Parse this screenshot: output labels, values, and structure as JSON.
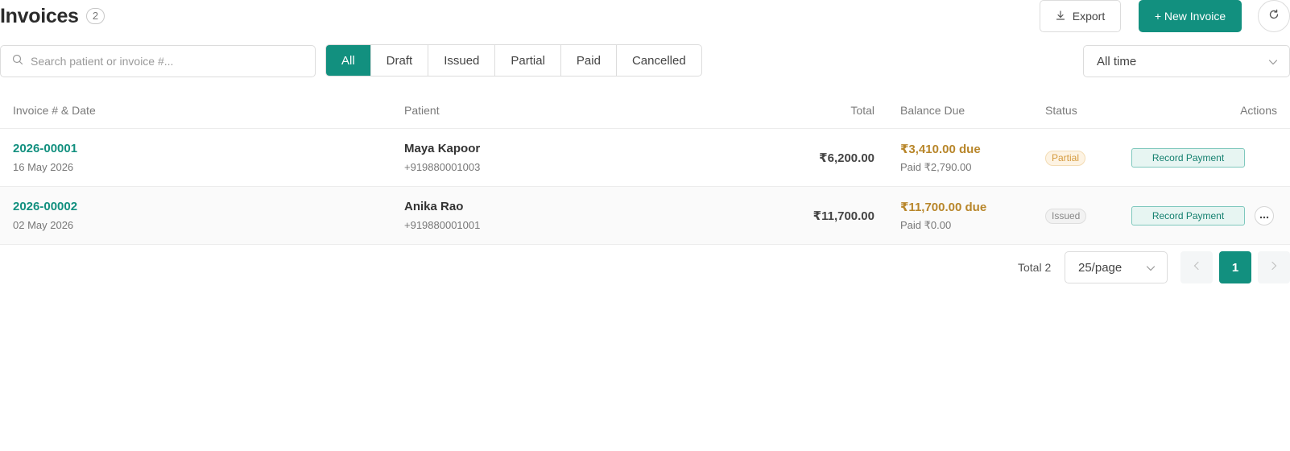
{
  "header": {
    "title": "Invoices",
    "count": "2",
    "export_label": "Export",
    "new_label": "+ New Invoice"
  },
  "filters": {
    "search_placeholder": "Search patient or invoice #...",
    "tabs": [
      "All",
      "Draft",
      "Issued",
      "Partial",
      "Paid",
      "Cancelled"
    ],
    "active_tab": "All",
    "time_range": "All time"
  },
  "table": {
    "columns": {
      "invoice": "Invoice # & Date",
      "patient": "Patient",
      "total": "Total",
      "balance": "Balance Due",
      "status": "Status",
      "actions": "Actions"
    },
    "rows": [
      {
        "invoice_no": "2026-00001",
        "date": "16 May 2026",
        "patient": "Maya Kapoor",
        "phone": "+919880001003",
        "total": "₹6,200.00",
        "due": "₹3,410.00 due",
        "paid": "Paid ₹2,790.00",
        "status": "Partial",
        "action": "Record Payment"
      },
      {
        "invoice_no": "2026-00002",
        "date": "02 May 2026",
        "patient": "Anika Rao",
        "phone": "+919880001001",
        "total": "₹11,700.00",
        "due": "₹11,700.00 due",
        "paid": "Paid ₹0.00",
        "status": "Issued",
        "action": "Record Payment"
      }
    ]
  },
  "pagination": {
    "total_label": "Total 2",
    "page_size": "25/page",
    "current_page": "1"
  },
  "colors": {
    "accent": "#12907f",
    "due": "#b8862a",
    "partial": "#d59b3f"
  },
  "icons": {
    "export": "download-icon",
    "refresh": "refresh-icon",
    "search": "search-icon",
    "select": "chevron-down-icon",
    "prev": "chevron-left-icon",
    "next": "chevron-right-icon",
    "more": "ellipsis-icon"
  }
}
